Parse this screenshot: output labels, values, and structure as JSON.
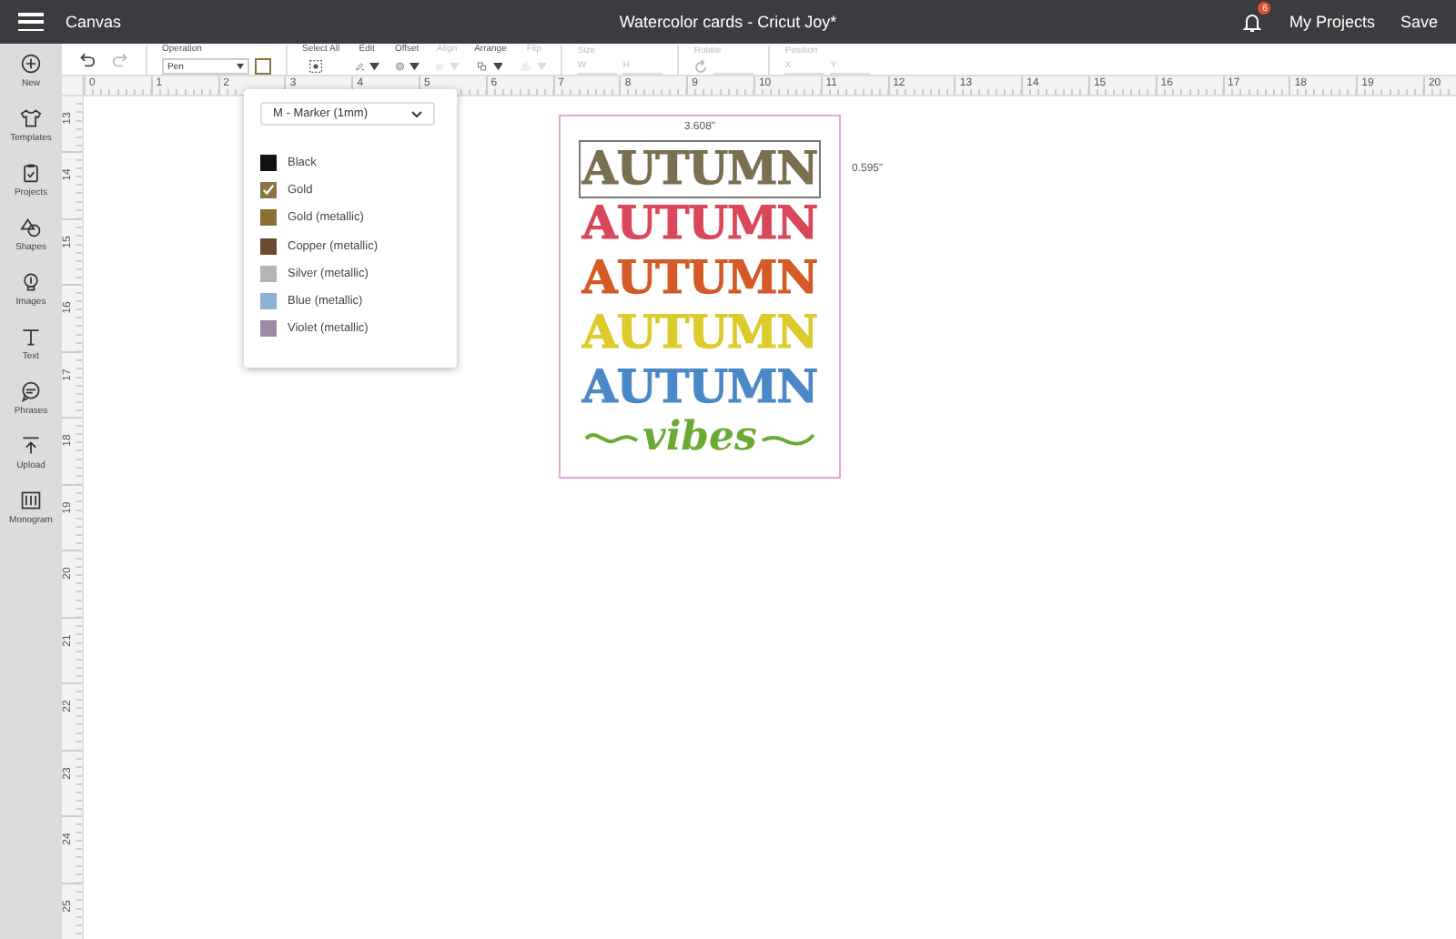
{
  "top_bar": {
    "menu": "Canvas",
    "title": "Watercolor cards - Cricut Joy*",
    "notification_count": "6",
    "links": [
      "My Projects",
      "Save"
    ]
  },
  "sidebar": {
    "items": [
      {
        "label": "New"
      },
      {
        "label": "Templates"
      },
      {
        "label": "Projects"
      },
      {
        "label": "Shapes"
      },
      {
        "label": "Images"
      },
      {
        "label": "Text"
      },
      {
        "label": "Phrases"
      },
      {
        "label": "Upload"
      },
      {
        "label": "Monogram"
      }
    ]
  },
  "toolbar": {
    "operation": {
      "label": "Operation",
      "value": "Pen"
    },
    "groups": [
      {
        "label": "Select All",
        "disabled": false
      },
      {
        "label": "Edit",
        "disabled": false
      },
      {
        "label": "Offset",
        "disabled": false
      },
      {
        "label": "Align",
        "disabled": true
      },
      {
        "label": "Arrange",
        "disabled": false
      },
      {
        "label": "Flip",
        "disabled": true
      }
    ],
    "fields": [
      {
        "label": "Size",
        "inputs": [
          "W",
          "H"
        ]
      },
      {
        "label": "Rotate"
      },
      {
        "label": "Position",
        "inputs": [
          "X",
          "Y"
        ]
      }
    ]
  },
  "rulers": {
    "horizontal": [
      "0",
      "1",
      "2",
      "3",
      "4",
      "5",
      "6",
      "7",
      "8",
      "9",
      "10",
      "11",
      "12",
      "13",
      "14",
      "15",
      "16",
      "17",
      "18",
      "19",
      "20"
    ],
    "vertical": [
      "13",
      "14",
      "15",
      "16",
      "17",
      "18",
      "19",
      "20",
      "21",
      "22",
      "23",
      "24",
      "25"
    ]
  },
  "pen_menu": {
    "pen_type": "M - Marker (1mm)",
    "colors": [
      {
        "name": "Black",
        "color": "#111111",
        "selected": false
      },
      {
        "name": "Gold",
        "color": "#8a7440",
        "selected": true
      },
      {
        "name": "Gold (metallic)",
        "color": "#8c6d36",
        "selected": false
      },
      {
        "name": "Copper (metallic)",
        "color": "#6a4a30",
        "selected": false
      },
      {
        "name": "Silver (metallic)",
        "color": "#b4b4b4",
        "selected": false
      },
      {
        "name": "Blue (metallic)",
        "color": "#8fb0d4",
        "selected": false
      },
      {
        "name": "Violet (metallic)",
        "color": "#9c8aa8",
        "selected": false
      }
    ]
  },
  "design": {
    "width": "3.608\"",
    "height": "0.595\"",
    "lines": [
      {
        "text": "AUTUMN",
        "color": "#7a7050",
        "selected": true
      },
      {
        "text": "AUTUMN",
        "color": "#d9485a",
        "selected": false
      },
      {
        "text": "AUTUMN",
        "color": "#d45a28",
        "selected": false
      },
      {
        "text": "AUTUMN",
        "color": "#dccb2c",
        "selected": false
      },
      {
        "text": "AUTUMN",
        "color": "#4a88c8",
        "selected": false
      },
      {
        "text": "vibes",
        "color": "#6aaa34",
        "selected": false
      }
    ]
  }
}
